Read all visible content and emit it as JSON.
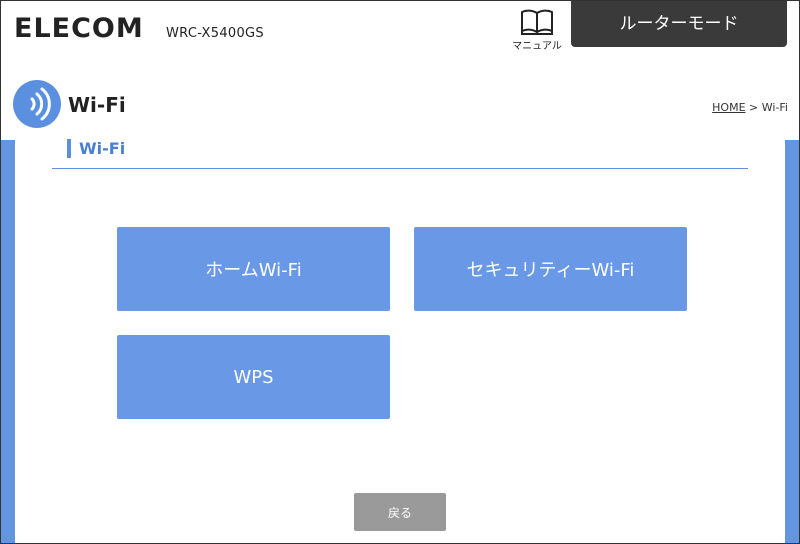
{
  "header": {
    "logo": "ELECOM",
    "model": "WRC-X5400GS",
    "manual_label": "マニュアル",
    "mode_label": "ルーターモード"
  },
  "page": {
    "title": "Wi-Fi",
    "breadcrumb_home": "HOME",
    "breadcrumb_sep": " > ",
    "breadcrumb_current": "Wi-Fi"
  },
  "section": {
    "title": "Wi-Fi"
  },
  "menu": {
    "home_wifi": "ホームWi-Fi",
    "security_wifi": "セキュリティーWi-Fi",
    "wps": "WPS"
  },
  "footer": {
    "back_label": "戻る"
  },
  "colors": {
    "accent": "#5b8fe0",
    "button": "#6898e6",
    "mode_box": "#3a3a3a",
    "back_button": "#9a9a9a"
  },
  "icons": {
    "manual": "book-icon",
    "title": "wifi-signal-icon"
  }
}
